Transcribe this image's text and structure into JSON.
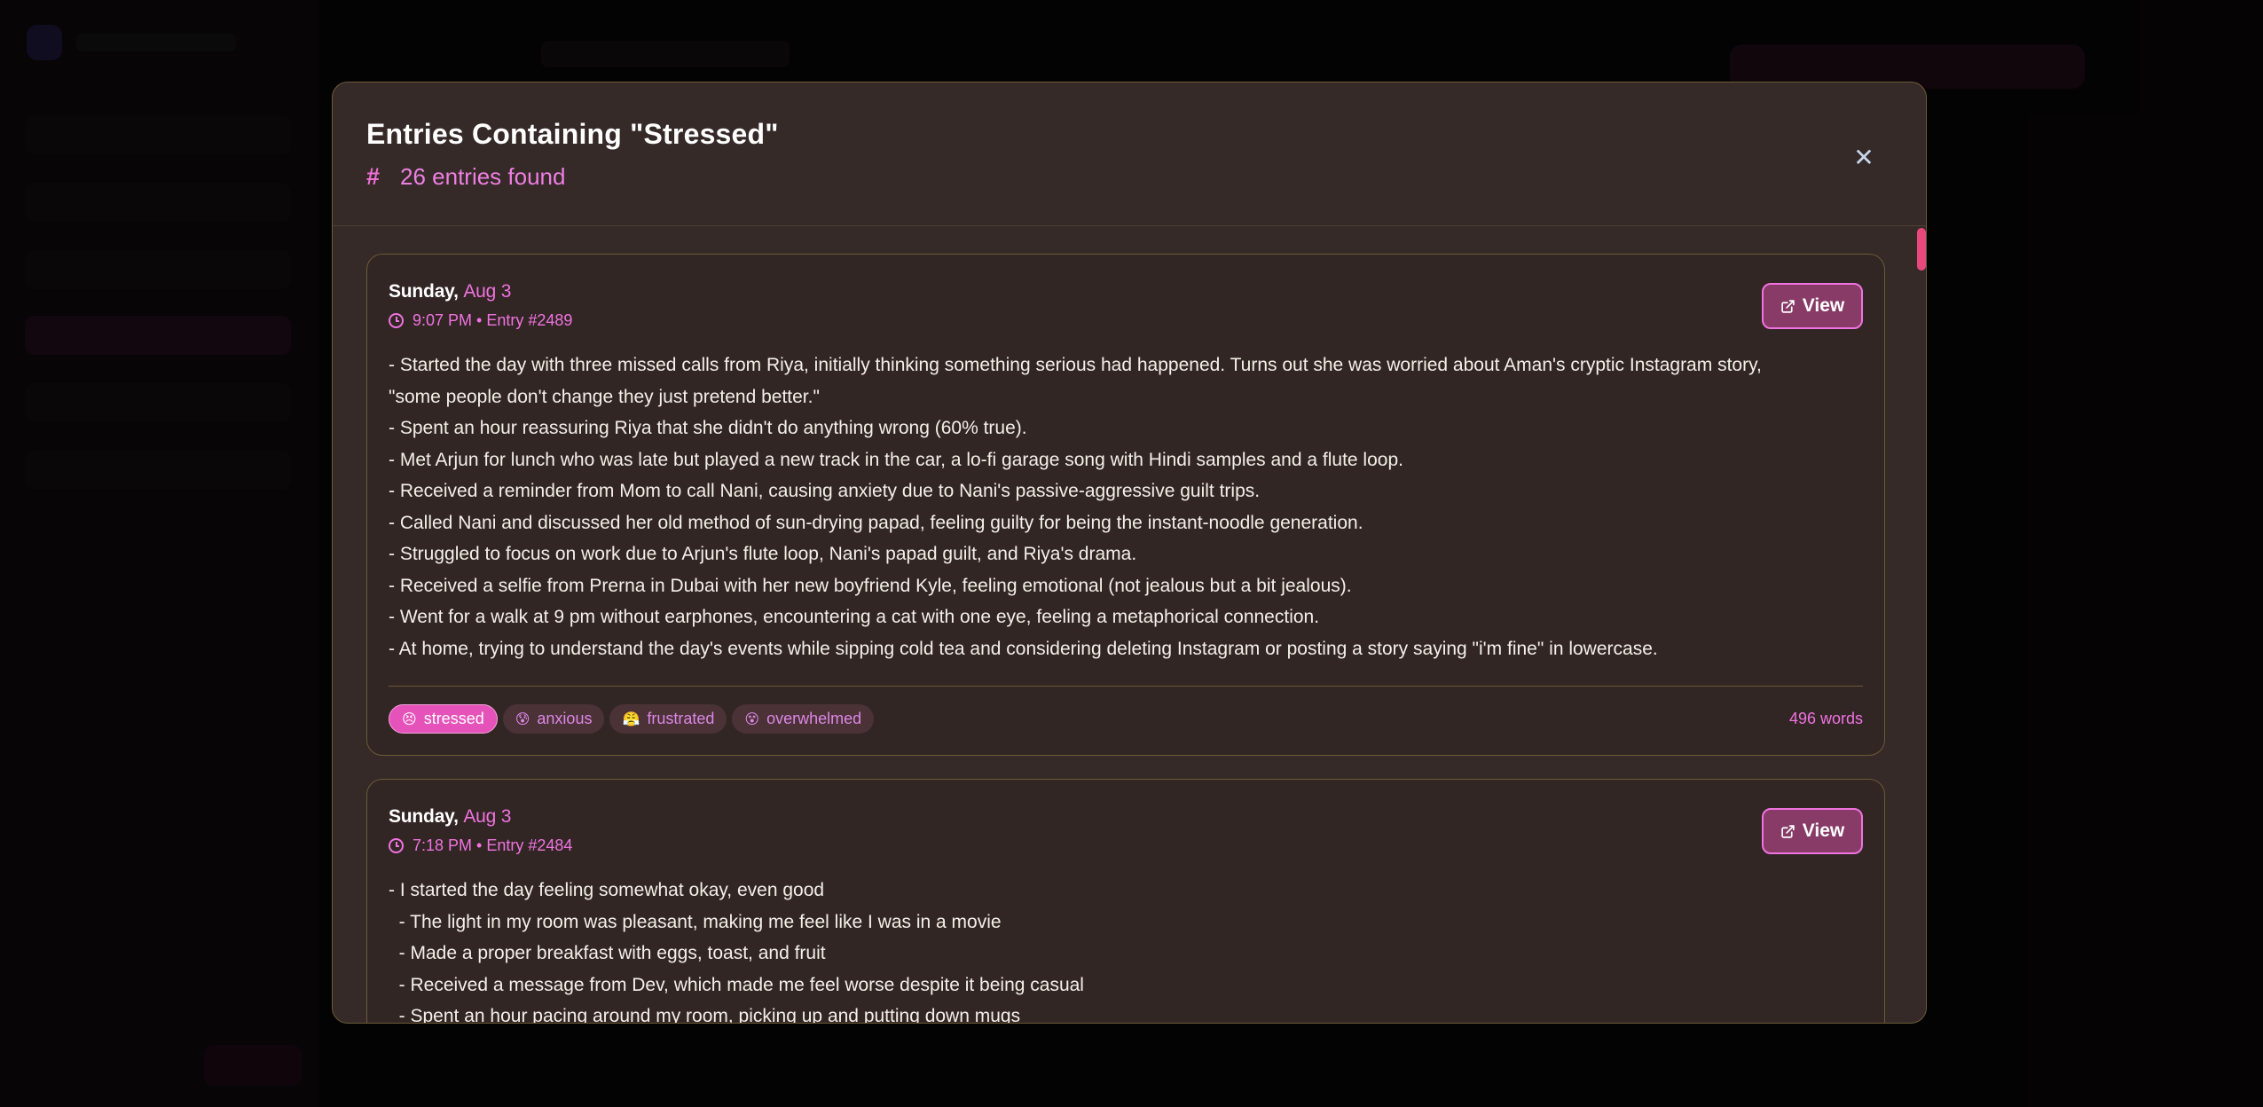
{
  "modal": {
    "title": "Entries Containing \"Stressed\"",
    "subtitle": "26 entries found",
    "close_label": "✕"
  },
  "entries": [
    {
      "weekday": "Sunday, ",
      "month_day": "Aug 3",
      "meta": "9:07 PM • Entry #2489",
      "view_label": "View",
      "lines": [
        "- Started the day with three missed calls from Riya, initially thinking something serious had happened. Turns out she was worried about Aman's cryptic Instagram story,",
        "\"some people don't change they just pretend better.\"",
        "- Spent an hour reassuring Riya that she didn't do anything wrong (60% true).",
        "- Met Arjun for lunch who was late but played a new track in the car, a lo-fi garage song with Hindi samples and a flute loop.",
        "- Received a reminder from Mom to call Nani, causing anxiety due to Nani's passive-aggressive guilt trips.",
        "- Called Nani and discussed her old method of sun-drying papad, feeling guilty for being the instant-noodle generation.",
        "- Struggled to focus on work due to Arjun's flute loop, Nani's papad guilt, and Riya's drama.",
        "- Received a selfie from Prerna in Dubai with her new boyfriend Kyle, feeling emotional (not jealous but a bit jealous).",
        "- Went for a walk at 9 pm without earphones, encountering a cat with one eye, feeling a metaphorical connection.",
        "- At home, trying to understand the day's events while sipping cold tea and considering deleting Instagram or posting a story saying \"i'm fine\" in lowercase."
      ],
      "tags": [
        {
          "emoji": "😣",
          "label": "stressed",
          "active": true
        },
        {
          "emoji": "😰",
          "label": "anxious",
          "active": false
        },
        {
          "emoji": "😤",
          "label": "frustrated",
          "active": false
        },
        {
          "emoji": "😵",
          "label": "overwhelmed",
          "active": false
        }
      ],
      "word_count": "496 words"
    },
    {
      "weekday": "Sunday, ",
      "month_day": "Aug 3",
      "meta": "7:18 PM • Entry #2484",
      "view_label": "View",
      "lines": [
        "- I started the day feeling somewhat okay, even good",
        "  - The light in my room was pleasant, making me feel like I was in a movie",
        "  - Made a proper breakfast with eggs, toast, and fruit",
        "  - Received a message from Dev, which made me feel worse despite it being casual",
        "  - Spent an hour pacing around my room, picking up and putting down mugs"
      ]
    }
  ],
  "colors": {
    "modal_bg": "#352a27",
    "border": "#6b5a37",
    "accent": "#ef73e0",
    "view_button": "#873b66",
    "active_tag": "#e552b9",
    "scroll_thumb": "#e8497d"
  }
}
